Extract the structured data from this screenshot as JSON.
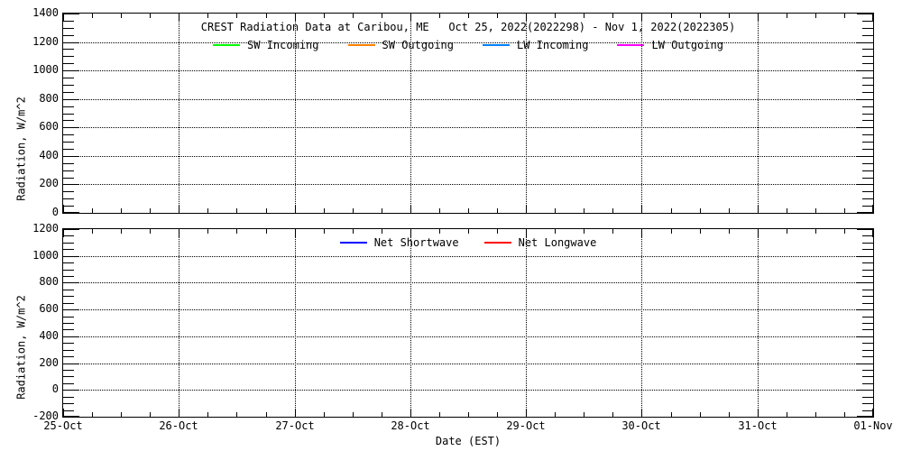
{
  "chart_data": [
    {
      "type": "line",
      "title": "CREST Radiation Data at Caribou, ME   Oct 25, 2022(2022298) - Nov 1, 2022(2022305)",
      "ylabel": "Radiation, W/m^2",
      "ylim": [
        0,
        1400
      ],
      "ytick_step": 200,
      "yminor_step": 50,
      "yticks": [
        "0",
        "200",
        "400",
        "600",
        "800",
        "1000",
        "1200",
        "1400"
      ],
      "xlim_days": [
        0,
        7
      ],
      "xtick_step_days": 1,
      "xminor_step_days": 0.25,
      "xticks": [],
      "grid": "dotted",
      "legend_position": "top-inside",
      "series": [
        {
          "name": "SW Incoming",
          "color": "#00ff00",
          "values": []
        },
        {
          "name": "SW Outgoing",
          "color": "#ff8000",
          "values": []
        },
        {
          "name": "LW Incoming",
          "color": "#0080ff",
          "values": []
        },
        {
          "name": "LW Outgoing",
          "color": "#ff00ff",
          "values": []
        }
      ],
      "note": "No data traces plotted; axes and grid only"
    },
    {
      "type": "line",
      "title": "",
      "ylabel": "Radiation, W/m^2",
      "xlabel": "Date (EST)",
      "ylim": [
        -200,
        1200
      ],
      "ytick_step": 200,
      "yminor_step": 50,
      "yticks": [
        "-200",
        "0",
        "200",
        "400",
        "600",
        "800",
        "1000",
        "1200"
      ],
      "xlim_days": [
        0,
        7
      ],
      "xtick_step_days": 1,
      "xminor_step_days": 0.25,
      "xticks": [
        "25-Oct",
        "26-Oct",
        "27-Oct",
        "28-Oct",
        "29-Oct",
        "30-Oct",
        "31-Oct",
        "01-Nov"
      ],
      "grid": "dotted",
      "legend_position": "top-inside",
      "series": [
        {
          "name": "Net Shortwave",
          "color": "#0000ff",
          "values": []
        },
        {
          "name": "Net Longwave",
          "color": "#ff0000",
          "values": []
        }
      ],
      "note": "No data traces plotted; axes and grid only"
    }
  ]
}
